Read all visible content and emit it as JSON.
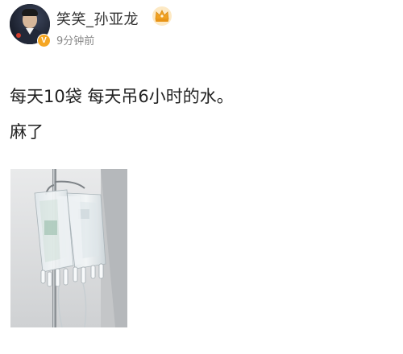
{
  "post": {
    "author": {
      "name": "笑笑_孙亚龙",
      "verified_badge": "V",
      "icons": [
        "avatar",
        "verified-badge-icon",
        "crown-icon"
      ]
    },
    "timestamp": "9分钟前",
    "content": {
      "line1": "每天10袋 每天吊6小时的水。",
      "line2": "麻了"
    },
    "colors": {
      "username": "#333333",
      "timestamp": "#8a8a8a",
      "verified": "#f5a623",
      "crown": "#f0a020"
    }
  }
}
